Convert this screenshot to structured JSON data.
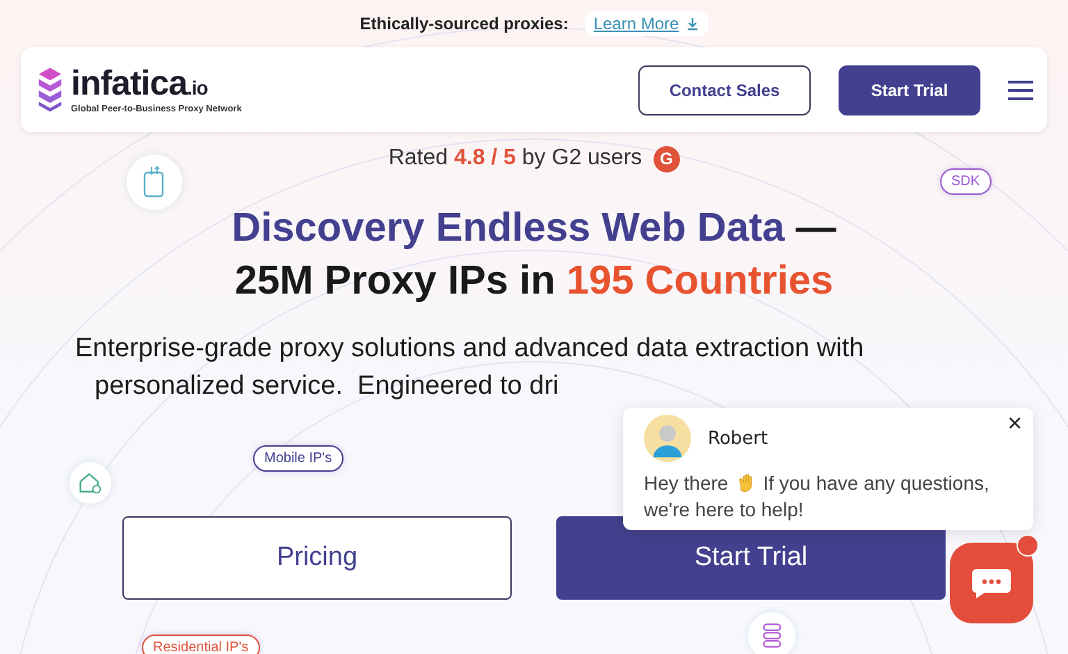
{
  "announcement": {
    "text": "Ethically-sourced proxies:",
    "link": "Learn More"
  },
  "header": {
    "logo": {
      "name": "infatica",
      "suffix": ".io",
      "tagline": "Global Peer-to-Business Proxy Network"
    },
    "buttons": [
      {
        "label": "Contact Sales",
        "kind": "outline"
      },
      {
        "label": "Start Trial",
        "kind": "primary"
      }
    ]
  },
  "rating": {
    "prefix": "Rated",
    "score": "4.8 / 5",
    "suffix": "by G2 users",
    "badge": "G"
  },
  "headline": {
    "line_1": "Discovery Endless Web Data",
    "dash": "—",
    "line_2_start": "25M Proxy IPs in",
    "line_2_highlight": "195 Countries"
  },
  "description": {
    "line_1": "Enterprise-grade proxy solutions and advanced data extraction with",
    "line_2": "personalized service.  Engineered to dri"
  },
  "cta_buttons": [
    {
      "label": "Pricing",
      "kind": "outline"
    },
    {
      "label": "Start Trial",
      "kind": "primary"
    }
  ],
  "floating_tags": [
    {
      "label": "SDK",
      "color": "#9b59d0"
    },
    {
      "label": "Mobile IP's",
      "color": "#43408f"
    },
    {
      "label": "Residential IP's",
      "color": "#e0533a"
    }
  ],
  "chat": {
    "agent": "Robert",
    "greeting": "Hey there",
    "message_line_1": "If you have any questions,",
    "message_line_2": "we're here to help!",
    "close": "×",
    "unread": true
  }
}
